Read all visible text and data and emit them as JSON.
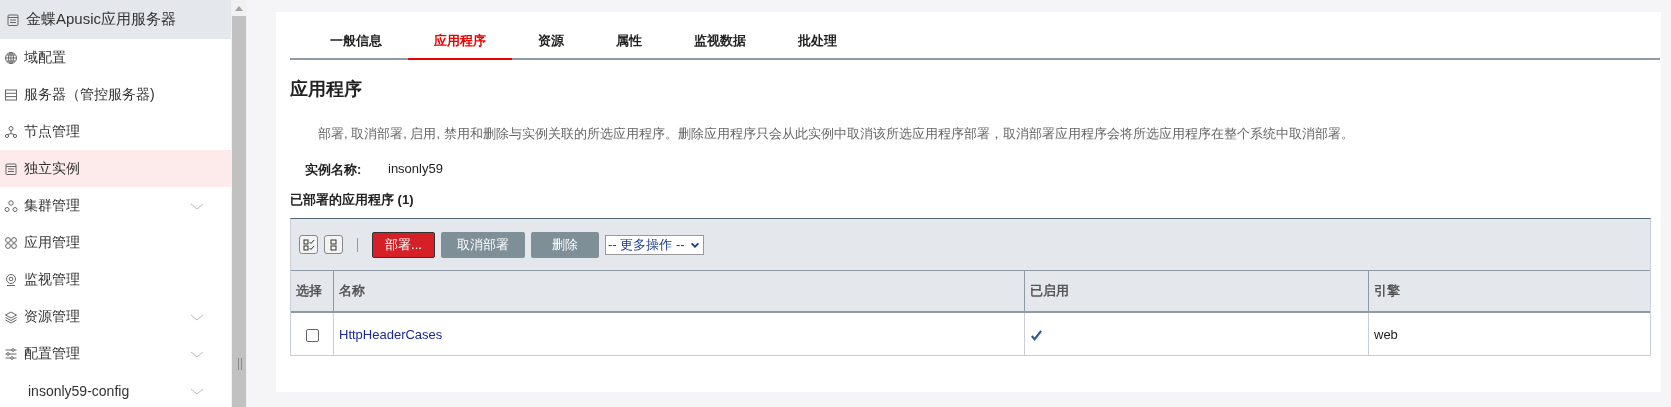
{
  "sidebar": {
    "header": {
      "label": "金蝶Apusic应用服务器"
    },
    "items": [
      {
        "label": "域配置",
        "kind": "link",
        "selected": false
      },
      {
        "label": "服务器（管控服务器)",
        "kind": "link",
        "selected": false
      },
      {
        "label": "节点管理",
        "kind": "link",
        "selected": false
      },
      {
        "label": "独立实例",
        "kind": "link",
        "selected": true
      },
      {
        "label": "集群管理",
        "kind": "group",
        "selected": false,
        "expanded": false
      },
      {
        "label": "应用管理",
        "kind": "link",
        "selected": false
      },
      {
        "label": "监视管理",
        "kind": "link",
        "selected": false
      },
      {
        "label": "资源管理",
        "kind": "group",
        "selected": false,
        "expanded": false
      },
      {
        "label": "配置管理",
        "kind": "group",
        "selected": false,
        "expanded": false
      },
      {
        "label": "insonly59-config",
        "kind": "subgroup",
        "selected": false,
        "expanded": false
      }
    ]
  },
  "tabs": [
    {
      "label": "一般信息",
      "selected": false
    },
    {
      "label": "应用程序",
      "selected": true
    },
    {
      "label": "资源",
      "selected": false
    },
    {
      "label": "属性",
      "selected": false
    },
    {
      "label": "监视数据",
      "selected": false
    },
    {
      "label": "批处理",
      "selected": false
    }
  ],
  "page": {
    "title": "应用程序",
    "description": "部署, 取消部署, 启用, 禁用和删除与实例关联的所选应用程序。删除应用程序只会从此实例中取消该所选应用程序部署，取消部署应用程序会将所选应用程序在整个系统中取消部署。",
    "instance_label": "实例名称:",
    "instance_value": "insonly59",
    "section_title": "已部署的应用程序 (1)"
  },
  "toolbar": {
    "buttons": [
      {
        "label": "部署...",
        "kind": "primary"
      },
      {
        "label": "取消部署",
        "kind": "secondary"
      },
      {
        "label": "删除",
        "kind": "secondary"
      }
    ],
    "more_actions": "-- 更多操作 --"
  },
  "table": {
    "columns": [
      "选择",
      "名称",
      "已启用",
      "引擎"
    ],
    "rows": [
      {
        "checked": false,
        "name": "HttpHeaderCases",
        "enabled": true,
        "engine": "web"
      }
    ]
  }
}
